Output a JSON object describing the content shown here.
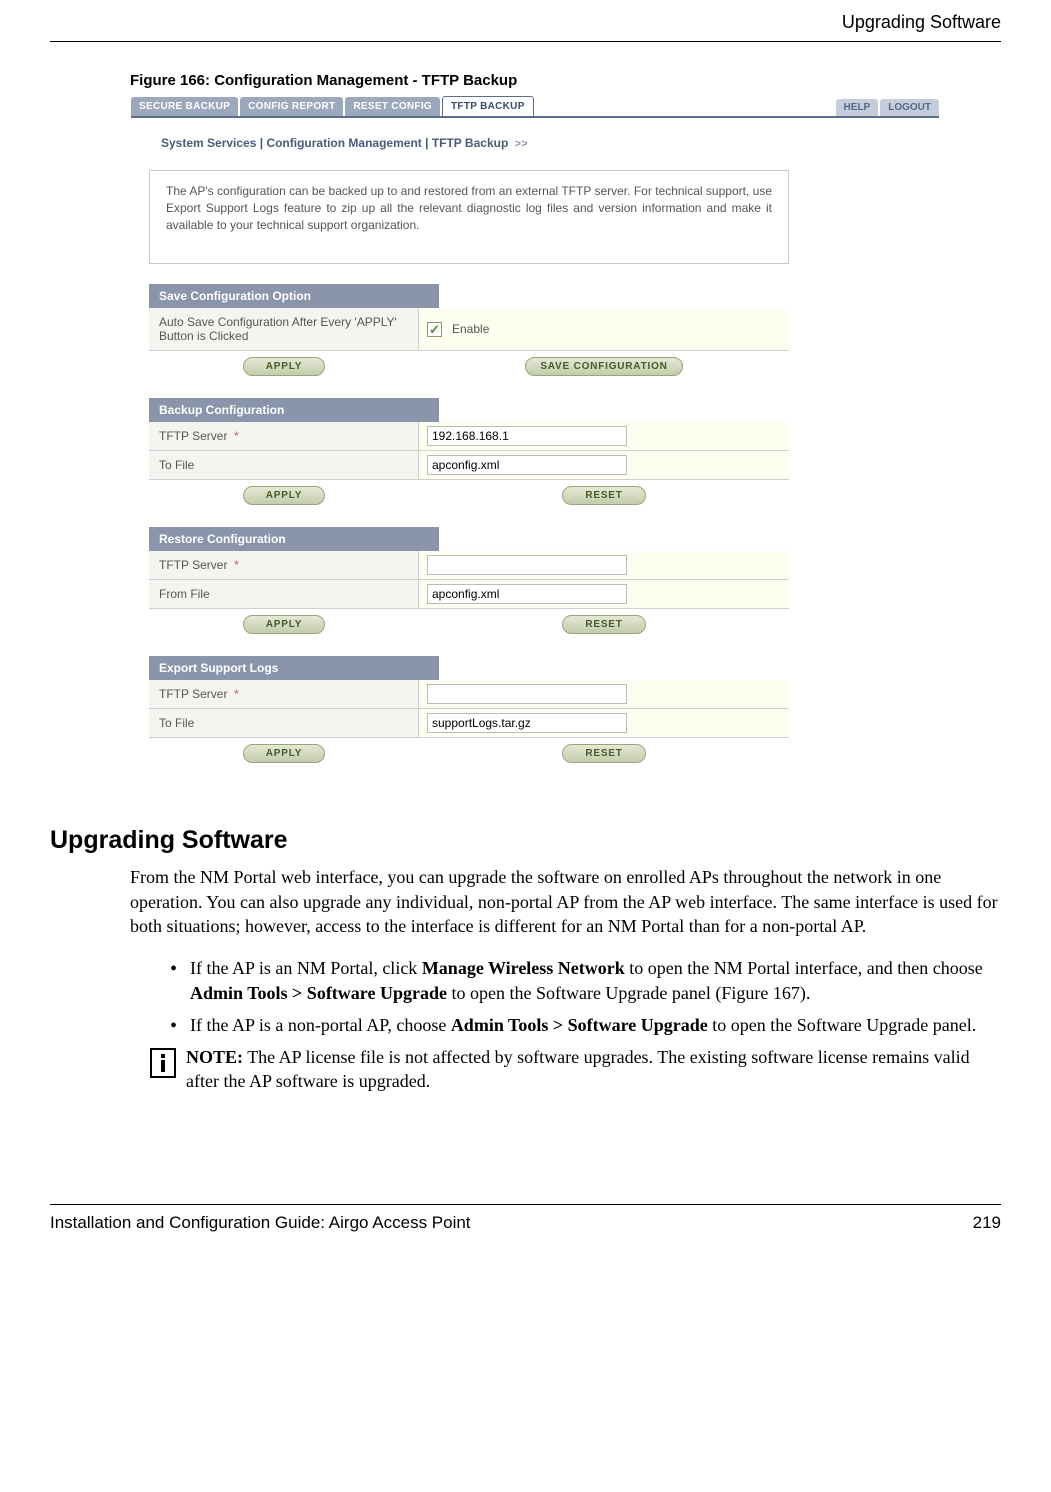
{
  "header": {
    "title": "Upgrading Software"
  },
  "figure": {
    "caption": "Figure 166:   Configuration Management - TFTP Backup"
  },
  "ui": {
    "tabs": {
      "secure_backup": "SECURE BACKUP",
      "config_report": "CONFIG REPORT",
      "reset_config": "RESET CONFIG",
      "tftp_backup": "TFTP BACKUP"
    },
    "top_buttons": {
      "help": "HELP",
      "logout": "LOGOUT"
    },
    "breadcrumb": {
      "a": "System Services",
      "b": "Configuration Management",
      "c": "TFTP Backup"
    },
    "description": "The AP's configuration can be backed up to and restored from an external TFTP server. For technical support, use Export Support Logs feature to zip up all the relevant diagnostic log files and version information and make it available to your technical support organization.",
    "save_opt": {
      "header": "Save Configuration Option",
      "row_label": "Auto Save Configuration After Every 'APPLY' Button is Clicked",
      "enable": "Enable",
      "apply": "APPLY",
      "save": "SAVE CONFIGURATION"
    },
    "backup": {
      "header": "Backup Configuration",
      "server_label": "TFTP Server",
      "server_value": "192.168.168.1",
      "file_label": "To File",
      "file_value": "apconfig.xml",
      "apply": "APPLY",
      "reset": "RESET"
    },
    "restore": {
      "header": "Restore Configuration",
      "server_label": "TFTP Server",
      "server_value": "",
      "file_label": "From File",
      "file_value": "apconfig.xml",
      "apply": "APPLY",
      "reset": "RESET"
    },
    "export": {
      "header": "Export Support Logs",
      "server_label": "TFTP Server",
      "server_value": "",
      "file_label": "To File",
      "file_value": "supportLogs.tar.gz",
      "apply": "APPLY",
      "reset": "RESET"
    },
    "req_marker": "*"
  },
  "section": {
    "title": "Upgrading Software",
    "intro": "From the NM Portal web interface, you can upgrade the software on enrolled APs throughout the network in one operation. You can also upgrade any individual, non-portal AP from the AP web interface. The same interface is used for both situations; however, access to the interface is different for an NM Portal than for a non-portal AP.",
    "b1_a": "If the AP is an NM Portal, click ",
    "b1_bold1": "Manage Wireless Network",
    "b1_b": " to open the NM Portal interface, and then choose ",
    "b1_bold2": "Admin Tools > Software Upgrade",
    "b1_c": " to open the Software Upgrade panel (Figure 167).",
    "b2_a": "If the AP is a non-portal AP, choose ",
    "b2_bold": "Admin Tools > Software Upgrade",
    "b2_b": " to open the Software Upgrade panel.",
    "note_label": "NOTE:",
    "note_text": " The AP license file is not affected by software upgrades. The existing software license remains valid after the AP software is upgraded."
  },
  "footer": {
    "left": "Installation and Configuration Guide: Airgo Access Point",
    "right": "219"
  }
}
